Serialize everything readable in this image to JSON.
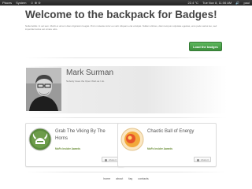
{
  "os_bar": {
    "left_items": [
      "Places",
      "System",
      "☺ ⊕ ⊖"
    ],
    "right_items": [
      "22.4 °C",
      "Tue Nov 8, 11:06 AM",
      "🔊",
      "paul"
    ]
  },
  "page": {
    "title": "Welcome to the backpack for Badges!",
    "intro": "Nulla facilisi. In vel sem. Morbi et urna in diam dignissim feugiat. Proin molestie tortor eu velit. Aliquam erat volutpat. Nullam ultrices, diam tempus vulputate egestas, eros pede varius leo, sed imperdiet lectus est ornare odio.",
    "load_button": "Load the badges"
  },
  "profile": {
    "name": "Mark Surman",
    "bio": "Nobody loves the Open Web as I do."
  },
  "badges": [
    {
      "title": "Grab The Viking By The Horns",
      "issuer": "MoFo Insider Awards",
      "share": "share it"
    },
    {
      "title": "Chaotic Ball of Energy",
      "issuer": "MoFo Insider Awards",
      "share": "share it"
    }
  ],
  "footer": {
    "links": [
      "home",
      "about",
      "faq",
      "contacts"
    ]
  },
  "colors": {
    "button_green": "#4aa84a",
    "issuer_green": "#6c8f3a",
    "badge_1": "#5a8a3c",
    "badge_2": "#f2a93b"
  }
}
